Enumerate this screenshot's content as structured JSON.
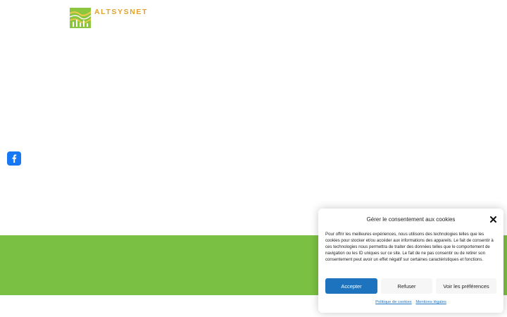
{
  "brand": {
    "name": "ALTSYSNET",
    "color": "#e2a32a"
  },
  "social": {
    "facebook_icon": "facebook-icon",
    "color": "#1877f2"
  },
  "band": {
    "color": "#7ac143"
  },
  "cookie_banner": {
    "title": "Gérer le consentement aux cookies",
    "close_icon": "close-icon",
    "text": "Pour offrir les meilleures expériences, nous utilisons des technologies telles que les cookies pour stocker et/ou accéder aux informations des appareils. Le fait de consentir à ces technologies nous permettra de traiter des données telles que le comportement de navigation ou les ID uniques sur ce site. Le fait de ne pas consentir ou de retirer son consentement peut avoir un effet négatif sur certaines caractéristiques et fonctions.",
    "accept_label": "Accepter",
    "refuse_label": "Refuser",
    "preferences_label": "Voir les préférences",
    "cookie_policy_label": "Politique de cookies",
    "legal_label": "Mentions légales",
    "accent": "#1e73be"
  }
}
